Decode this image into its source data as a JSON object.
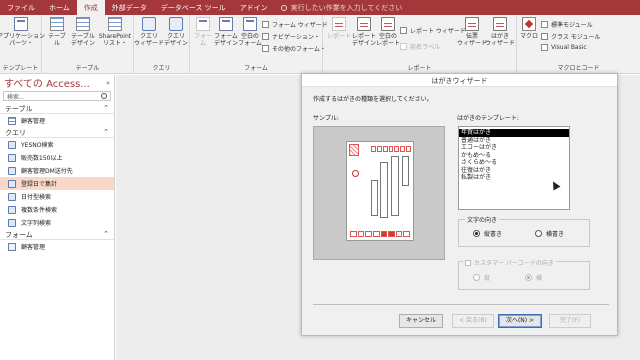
{
  "tabs": [
    {
      "label": "ファイル"
    },
    {
      "label": "ホーム"
    },
    {
      "label": "作成"
    },
    {
      "label": "外部データ"
    },
    {
      "label": "データベース ツール"
    },
    {
      "label": "アドイン"
    }
  ],
  "active_tab": "作成",
  "tell_me": "実行したい作業を入力してください",
  "ribbon": {
    "templates": {
      "label": "テンプレート",
      "app_parts": "アプリケーション\nパーツ・"
    },
    "tables": {
      "label": "テーブル",
      "table": "テーブル",
      "table_design": "テーブル\nデザイン",
      "sharepoint": "SharePoint\nリスト・"
    },
    "queries": {
      "label": "クエリ",
      "wizard": "クエリ\nウィザード",
      "design": "クエリ\nデザイン"
    },
    "forms": {
      "label": "フォーム",
      "form": "フォーム",
      "form_design": "フォーム\nデザイン",
      "blank_form": "空白の\nフォーム",
      "form_wizard": "フォーム ウィザード",
      "navigation": "ナビゲーション・",
      "more_forms": "その他のフォーム・"
    },
    "reports": {
      "label": "レポート",
      "report": "レポート",
      "report_design": "レポート\nデザイン",
      "blank_report": "空白の\nレポート",
      "report_wizard": "レポート ウィザード",
      "labels": "宛名ラベル",
      "postcard_wizard": "伝票\nウィザード",
      "hagaki_wizard": "はがき\nウィザード"
    },
    "macros": {
      "label": "マクロとコード",
      "macro": "マクロ",
      "std_module": "標準モジュール",
      "class_module": "クラス モジュール",
      "vba": "Visual Basic"
    }
  },
  "nav": {
    "title": "すべての Access...",
    "search_placeholder": "検索...",
    "sections": [
      {
        "label": "テーブル",
        "items": [
          {
            "label": "顧客管理",
            "icon": "table-icon"
          }
        ]
      },
      {
        "label": "クエリ",
        "items": [
          {
            "label": "YESNO検索",
            "icon": "query-icon"
          },
          {
            "label": "販売数150以上",
            "icon": "query-icon"
          },
          {
            "label": "顧客管理DM送付先",
            "icon": "query-icon"
          },
          {
            "label": "登録日で集計",
            "icon": "query-icon"
          },
          {
            "label": "日付型検索",
            "icon": "query-icon"
          },
          {
            "label": "複数条件検索",
            "icon": "query-icon"
          },
          {
            "label": "文字列検索",
            "icon": "query-icon"
          }
        ]
      },
      {
        "label": "フォーム",
        "items": [
          {
            "label": "顧客管理",
            "icon": "form-icon"
          }
        ]
      }
    ],
    "selected_item": "登録日で集計"
  },
  "wizard": {
    "title": "はがきウィザード",
    "instruction": "作成するはがきの種類を選択してください。",
    "sample_label": "サンプル:",
    "template_label": "はがきのテンプレート:",
    "templates": [
      "年賀はがき",
      "普通はがき",
      "エコーはがき",
      "かもめ～る",
      "さくらめ～る",
      "往復はがき",
      "私製はがき"
    ],
    "selected_template": "年賀はがき",
    "text_direction": {
      "label": "文字の向き",
      "options": [
        "縦書き",
        "横書き"
      ],
      "selected": "縦書き"
    },
    "barcode": {
      "label": "カスタマー バーコードの向き",
      "options": [
        "縦",
        "横"
      ],
      "selected": "横",
      "checked": false
    },
    "buttons": {
      "cancel": "キャンセル",
      "back": "< 戻る(B)",
      "next": "次へ(N) >",
      "finish": "完了(F)"
    }
  }
}
